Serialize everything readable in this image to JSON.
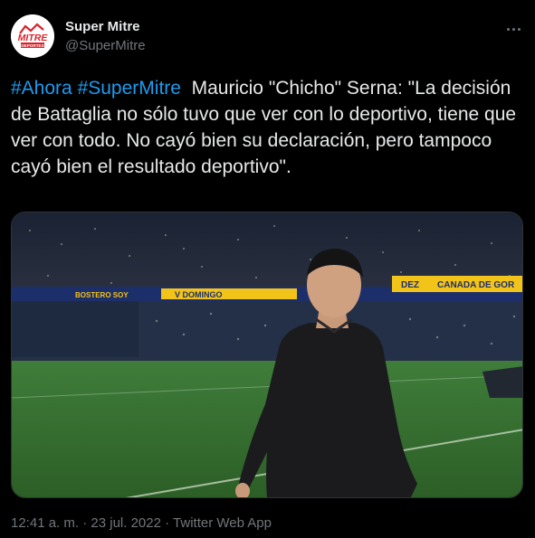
{
  "author": {
    "display_name": "Super Mitre",
    "handle": "@SuperMitre",
    "avatar_logo_text": "MITRE",
    "avatar_logo_subtext": "DEPORTES"
  },
  "tweet": {
    "hashtags": [
      "#Ahora",
      "#SuperMitre"
    ],
    "body": "Mauricio \"Chicho\" Serna: \"La decisión  de Battaglia no sólo tuvo que ver con lo deportivo, tiene que ver con todo. No cayó bien su declaración, pero tampoco cayó bien el resultado deportivo\"."
  },
  "photo": {
    "banner_texts": [
      "V DOMINGO",
      "BOSTERO SOY",
      "CANADA DE GOR",
      "DEZ"
    ]
  },
  "meta": {
    "time": "12:41 a. m.",
    "separator": " · ",
    "date": "23 jul. 2022",
    "source": "Twitter Web App"
  },
  "icons": {
    "more": "more-options-icon"
  },
  "colors": {
    "background": "#000000",
    "text": "#e7e9ea",
    "secondary": "#71767b",
    "link": "#1d9bf0",
    "brand_red": "#d8232a"
  }
}
